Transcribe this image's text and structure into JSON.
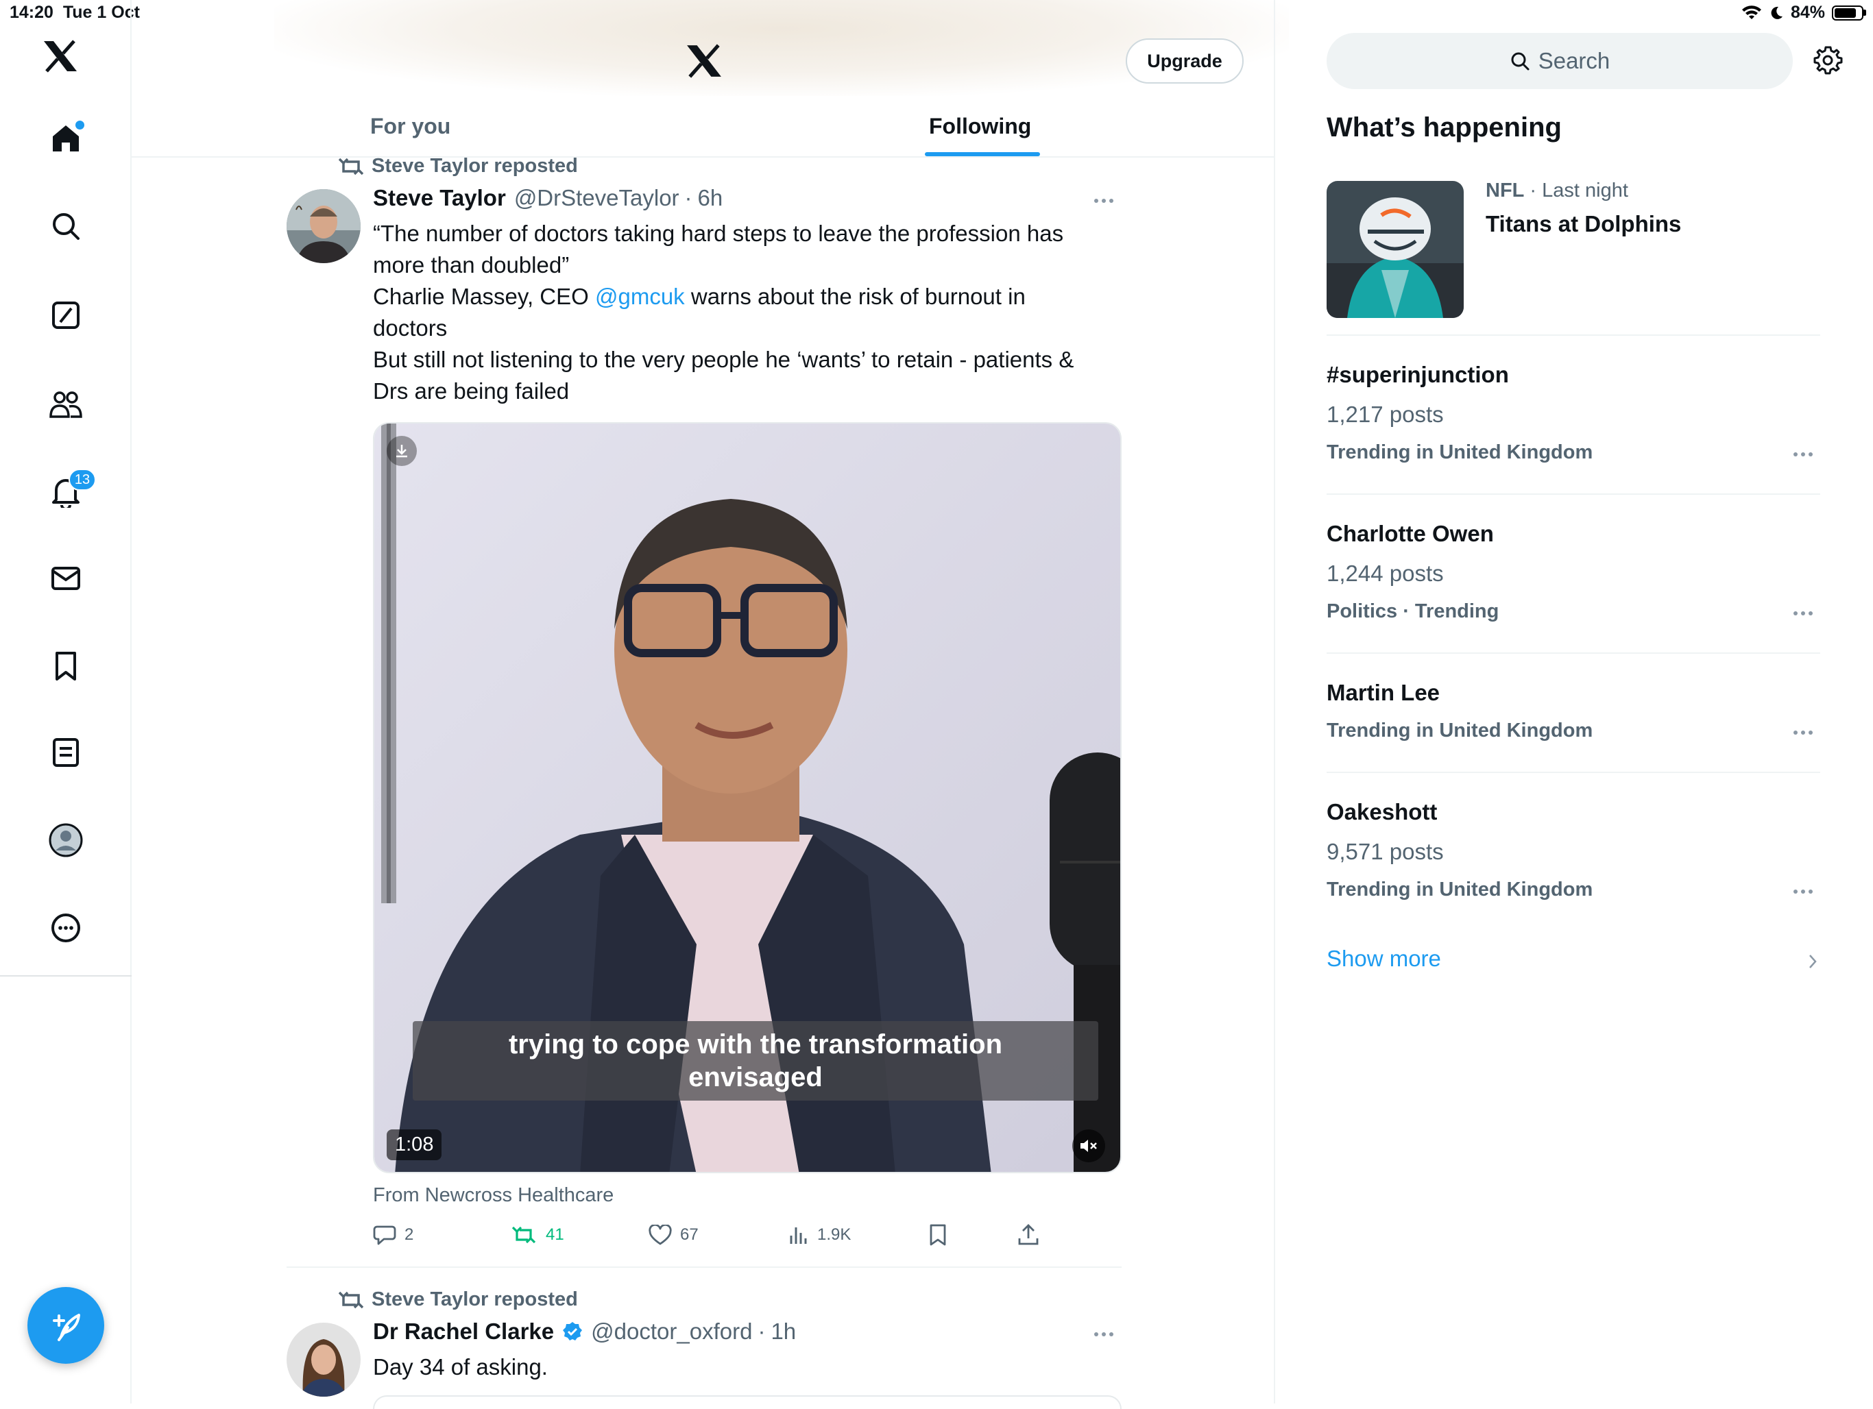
{
  "status_bar": {
    "time": "14:20",
    "date": "Tue 1 Oct",
    "battery": "84%",
    "battery_level": 0.84
  },
  "colors": {
    "accent": "#1d9bf0",
    "retweet_green": "#00ba7c",
    "text_secondary": "#536471"
  },
  "left_nav": {
    "items": [
      {
        "name": "home",
        "icon": "home-icon"
      },
      {
        "name": "explore",
        "icon": "search-icon"
      },
      {
        "name": "grok",
        "icon": "grok-icon"
      },
      {
        "name": "communities",
        "icon": "communities-icon"
      },
      {
        "name": "notifications",
        "icon": "bell-icon",
        "badge": "13"
      },
      {
        "name": "messages",
        "icon": "mail-icon"
      },
      {
        "name": "bookmarks",
        "icon": "bookmark-icon"
      },
      {
        "name": "lists",
        "icon": "list-icon"
      },
      {
        "name": "profile",
        "icon": "profile-icon"
      },
      {
        "name": "more",
        "icon": "more-circle-icon"
      }
    ]
  },
  "header": {
    "upgrade_label": "Upgrade"
  },
  "tabs": [
    {
      "label": "For you"
    },
    {
      "label": "Following"
    }
  ],
  "tweets": [
    {
      "repost_label": "Steve Taylor reposted",
      "name": "Steve Taylor",
      "handle": "@DrSteveTaylor",
      "sep": "·",
      "time": "6h",
      "lines": [
        "“The number of doctors taking hard steps to leave the profession has",
        "more than doubled”",
        "Charlie Massey, CEO ",
        "@gmcuk",
        " warns about the risk of burnout in",
        "doctors",
        "But still not listening to the very people he ‘wants’ to retain - patients &",
        "Drs are being failed"
      ],
      "video": {
        "caption_line1": "trying to cope with the transformation",
        "caption_line2": "envisaged",
        "duration": "1:08"
      },
      "from": "From Newcross Healthcare",
      "actions": {
        "replies": "2",
        "reposts": "41",
        "likes": "67",
        "views": "1.9K"
      }
    },
    {
      "repost_label": "Steve Taylor reposted",
      "name": "Dr Rachel Clarke",
      "handle": "@doctor_oxford",
      "sep": "·",
      "time": "1h",
      "text": "Day 34 of asking."
    }
  ],
  "right": {
    "search_placeholder": "Search",
    "whats_happening": "What’s happening",
    "featured": {
      "category": "NFL",
      "sep": " · ",
      "when": "Last night",
      "title": "Titans at Dolphins"
    },
    "trends": [
      {
        "title": "#superinjunction",
        "posts": "1,217 posts",
        "meta": "Trending in United Kingdom"
      },
      {
        "title": "Charlotte Owen",
        "posts": "1,244 posts",
        "meta": "Politics · Trending"
      },
      {
        "title": "Martin Lee",
        "posts": "",
        "meta": "Trending in United Kingdom"
      },
      {
        "title": "Oakeshott",
        "posts": "9,571 posts",
        "meta": "Trending in United Kingdom"
      }
    ],
    "show_more": "Show more"
  }
}
